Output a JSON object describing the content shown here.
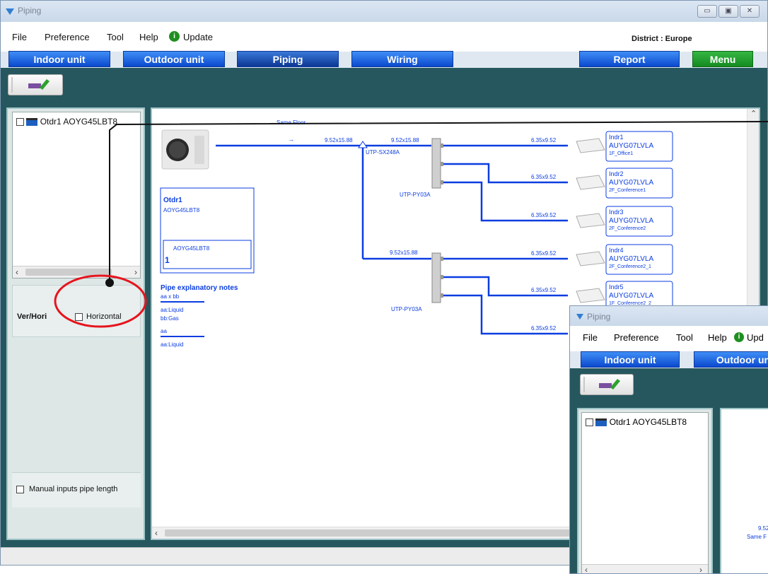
{
  "window": {
    "title": "Piping"
  },
  "menu": {
    "file": "File",
    "preference": "Preference",
    "tool": "Tool",
    "help": "Help",
    "update": "Update"
  },
  "district": "District : Europe",
  "nav": {
    "indoor": "Indoor unit",
    "outdoor": "Outdoor unit",
    "piping": "Piping",
    "wiring": "Wiring",
    "report": "Report",
    "menu": "Menu"
  },
  "tree": {
    "item": "Otdr1 AOYG45LBT8"
  },
  "verhori": {
    "label": "Ver/Hori",
    "horizontal": "Horizontal"
  },
  "manual_inputs": "Manual inputs pipe length",
  "diagram": {
    "same_floor": "Same Floor",
    "outdoor_box": {
      "title": "Otdr1",
      "model": "AOYG45LBT8",
      "inner_model": "AOYG45LBT8",
      "count": "1"
    },
    "notes": {
      "title": "Pipe explanatory notes",
      "line1": "aa x bb",
      "liquid1": "aa:Liquid",
      "gas": "bb:Gas",
      "line2": "aa",
      "liquid2": "aa:Liquid"
    },
    "main_pipe_1": "9.52x15.88",
    "main_pipe_2": "9.52x15.88",
    "separator": "UTP-SX248A",
    "branch_pipe": "9.52x15.88",
    "header1": "UTP-PY03A",
    "header2": "UTP-PY03A",
    "arrow": "→",
    "indoor_pipe": "6.35x9.52",
    "indoors": [
      {
        "name": "Indr1",
        "model": "AUYG07LVLA",
        "room": "1F_Office1"
      },
      {
        "name": "Indr2",
        "model": "AUYG07LVLA",
        "room": "2F_Conference1"
      },
      {
        "name": "Indr3",
        "model": "AUYG07LVLA",
        "room": "2F_Conference2"
      },
      {
        "name": "Indr4",
        "model": "AUYG07LVLA",
        "room": "2F_Conference2_1"
      },
      {
        "name": "Indr5",
        "model": "AUYG07LVLA",
        "room": "1F_Conference2_2"
      }
    ]
  },
  "overlay": {
    "title": "Piping",
    "menu": {
      "file": "File",
      "preference": "Preference",
      "tool": "Tool",
      "help": "Help",
      "update": "Upd"
    },
    "nav": {
      "indoor": "Indoor unit",
      "outdoor": "Outdoor un"
    },
    "tree_item": "Otdr1 AOYG45LBT8",
    "pipe": "9.52",
    "same": "Same F"
  },
  "colors": {
    "accent_blue": "#0b3de0",
    "teal": "#26575e",
    "annotation_red": "#e6141d"
  }
}
